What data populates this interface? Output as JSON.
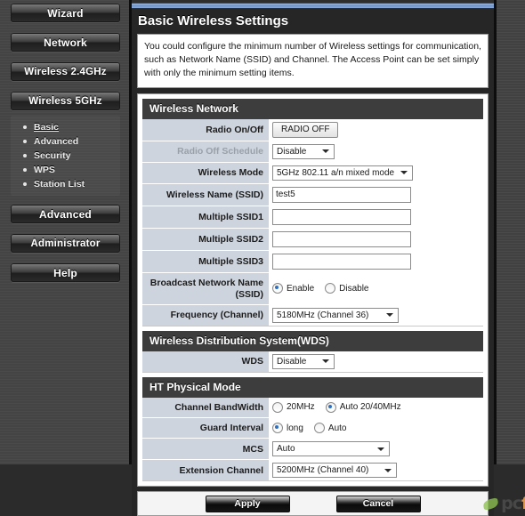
{
  "sidebar": {
    "buttons": [
      {
        "label": "Wizard"
      },
      {
        "label": "Network"
      },
      {
        "label": "Wireless 2.4GHz"
      },
      {
        "label": "Wireless 5GHz"
      }
    ],
    "submenu": [
      {
        "label": "Basic",
        "active": true
      },
      {
        "label": "Advanced",
        "active": false
      },
      {
        "label": "Security",
        "active": false
      },
      {
        "label": "WPS",
        "active": false
      },
      {
        "label": "Station List",
        "active": false
      }
    ],
    "buttons_lower": [
      {
        "label": "Advanced"
      },
      {
        "label": "Administrator"
      },
      {
        "label": "Help"
      }
    ]
  },
  "page": {
    "title": "Basic Wireless Settings",
    "description": "You could configure the minimum number of Wireless settings for communication, such as Network Name (SSID) and Channel. The Access Point can be set simply with only the minimum setting items."
  },
  "wireless_network": {
    "heading": "Wireless Network",
    "radio_on_off": {
      "label": "Radio On/Off",
      "button_label": "RADIO OFF"
    },
    "radio_off_schedule": {
      "label": "Radio Off Schedule",
      "value": "Disable",
      "disabled": true
    },
    "wireless_mode": {
      "label": "Wireless Mode",
      "value": "5GHz 802.11 a/n mixed mode"
    },
    "ssid": {
      "label": "Wireless Name (SSID)",
      "value": "test5",
      "placeholder": ""
    },
    "multiple_ssid1": {
      "label": "Multiple SSID1",
      "value": "",
      "placeholder": ""
    },
    "multiple_ssid2": {
      "label": "Multiple SSID2",
      "value": "",
      "placeholder": ""
    },
    "multiple_ssid3": {
      "label": "Multiple SSID3",
      "value": "",
      "placeholder": ""
    },
    "broadcast_ssid": {
      "label_line1": "Broadcast Network Name",
      "label_line2": "(SSID)",
      "enable_label": "Enable",
      "disable_label": "Disable",
      "selected": "Enable"
    },
    "frequency": {
      "label": "Frequency (Channel)",
      "value": "5180MHz (Channel 36)"
    }
  },
  "wds": {
    "heading": "Wireless Distribution System(WDS)",
    "wds": {
      "label": "WDS",
      "value": "Disable"
    }
  },
  "ht_physical_mode": {
    "heading": "HT Physical Mode",
    "channel_bandwidth": {
      "label": "Channel BandWidth",
      "option1": "20MHz",
      "option2": "Auto 20/40MHz",
      "selected": "Auto 20/40MHz"
    },
    "guard_interval": {
      "label": "Guard Interval",
      "option1": "long",
      "option2": "Auto",
      "selected": "long"
    },
    "mcs": {
      "label": "MCS",
      "value": "Auto"
    },
    "extension_channel": {
      "label": "Extension Channel",
      "value": "5200MHz (Channel 40)"
    }
  },
  "footer": {
    "apply_label": "Apply",
    "cancel_label": "Cancel",
    "watermark_part1": "pc",
    "watermark_part2": "foster"
  }
}
